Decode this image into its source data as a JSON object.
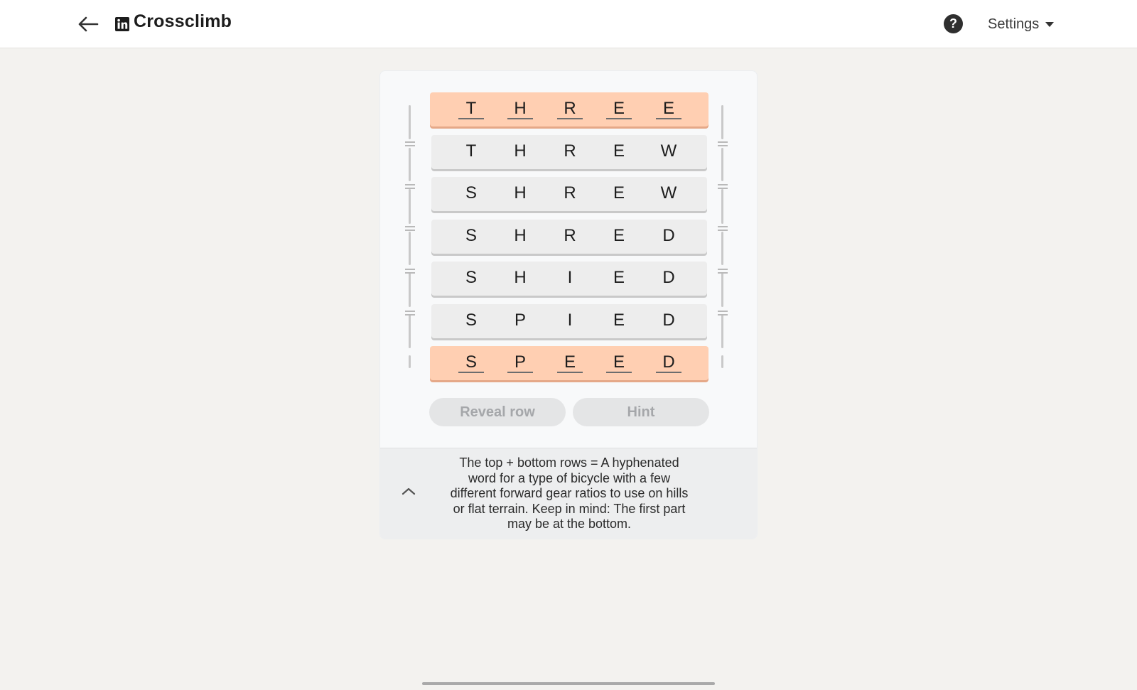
{
  "header": {
    "back_icon": "arrow-left-icon",
    "logo_icon": "linkedin-icon",
    "title": "Crossclimb",
    "help_icon": "question-circle-icon",
    "help_label": "?",
    "settings_label": "Settings",
    "settings_caret_icon": "caret-down-icon"
  },
  "colors": {
    "fixed_row": "#ffcfb2",
    "movable_row": "#ededed",
    "page_background": "#f3f2ef"
  },
  "puzzle": {
    "rows": [
      {
        "letters": [
          "T",
          "H",
          "R",
          "E",
          "E"
        ],
        "fixed": true
      },
      {
        "letters": [
          "T",
          "H",
          "R",
          "E",
          "W"
        ],
        "fixed": false
      },
      {
        "letters": [
          "S",
          "H",
          "R",
          "E",
          "W"
        ],
        "fixed": false
      },
      {
        "letters": [
          "S",
          "H",
          "R",
          "E",
          "D"
        ],
        "fixed": false
      },
      {
        "letters": [
          "S",
          "H",
          "I",
          "E",
          "D"
        ],
        "fixed": false
      },
      {
        "letters": [
          "S",
          "P",
          "I",
          "E",
          "D"
        ],
        "fixed": false
      },
      {
        "letters": [
          "S",
          "P",
          "E",
          "E",
          "D"
        ],
        "fixed": true
      }
    ]
  },
  "actions": {
    "reveal_row_label": "Reveal row",
    "hint_label": "Hint"
  },
  "clue": {
    "toggle_icon": "chevron-up-icon",
    "text": "The top + bottom rows = A hyphenated word for a type of bicycle with a few different forward gear ratios to use on hills or flat terrain. Keep in mind: The first part may be at the bottom."
  }
}
